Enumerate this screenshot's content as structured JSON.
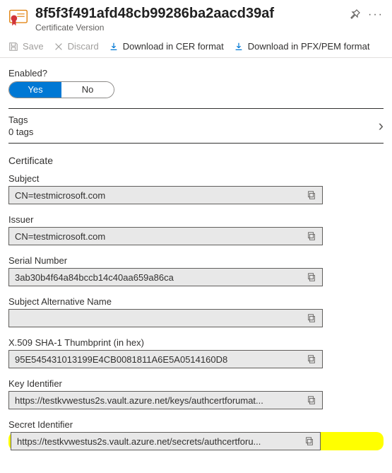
{
  "header": {
    "title": "8f5f3f491afd48cb99286ba2aacd39af",
    "subtitle": "Certificate Version"
  },
  "toolbar": {
    "save": "Save",
    "discard": "Discard",
    "download_cer": "Download in CER format",
    "download_pfx": "Download in PFX/PEM format"
  },
  "enabled": {
    "label": "Enabled?",
    "yes": "Yes",
    "no": "No"
  },
  "tags": {
    "label": "Tags",
    "count": "0 tags"
  },
  "certificate": {
    "section_label": "Certificate",
    "subject_label": "Subject",
    "subject_value": "CN=testmicrosoft.com",
    "issuer_label": "Issuer",
    "issuer_value": "CN=testmicrosoft.com",
    "serial_label": "Serial Number",
    "serial_value": "3ab30b4f64a84bccb14c40aa659a86ca",
    "san_label": "Subject Alternative Name",
    "san_value": "",
    "thumb_label": "X.509 SHA-1 Thumbprint (in hex)",
    "thumb_value": "95E545431013199E4CB0081811A6E5A0514160D8",
    "key_label": "Key Identifier",
    "key_value": "https://testkvwestus2s.vault.azure.net/keys/authcertforumat...",
    "secret_label": "Secret Identifier",
    "secret_value": "https://testkvwestus2s.vault.azure.net/secrets/authcertforu..."
  }
}
